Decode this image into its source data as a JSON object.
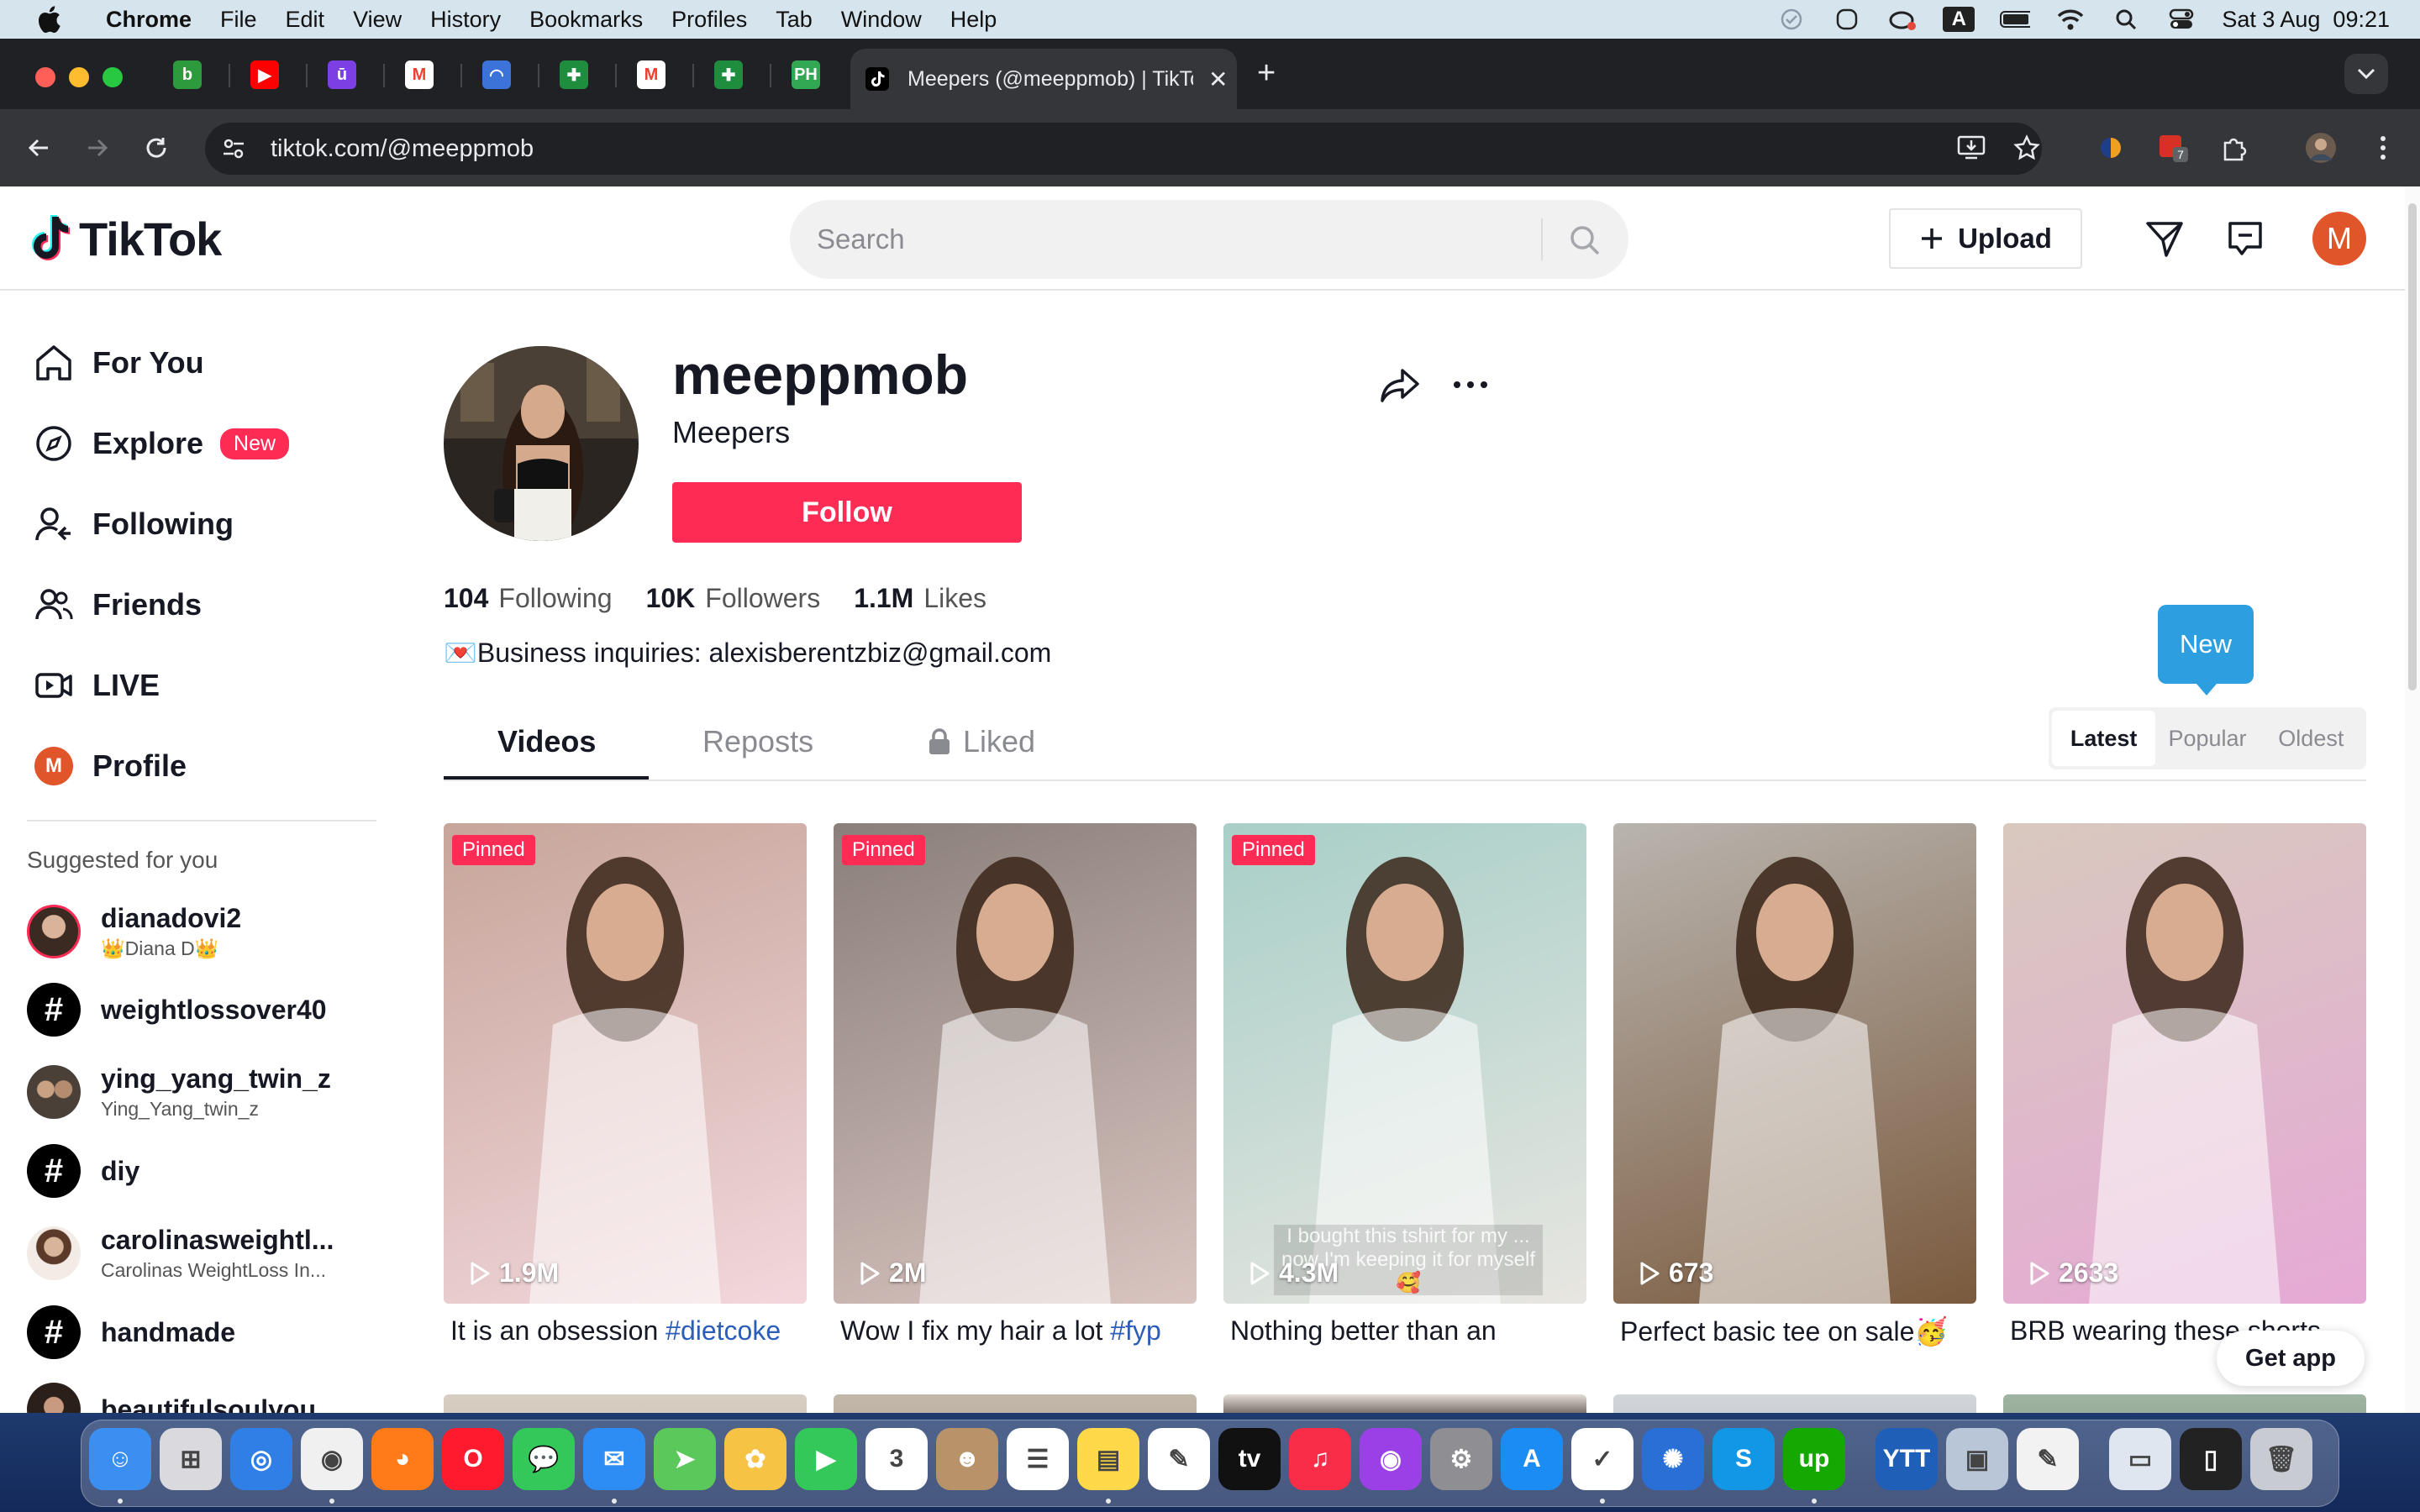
{
  "menubar": {
    "app": "Chrome",
    "items": [
      "File",
      "Edit",
      "View",
      "History",
      "Bookmarks",
      "Profiles",
      "Tab",
      "Window",
      "Help"
    ],
    "clock": "Sat 3 Aug  09:21",
    "input_indicator": "A"
  },
  "browser": {
    "active_tab_title": "Meepers (@meeppmob) | TikTok",
    "url": "tiktok.com/@meeppmob",
    "new_tab": "+",
    "close_tab": "✕",
    "pinned_tabs": [
      {
        "icon": "b-green-icon",
        "letter": "b",
        "color": "#2e9a3e"
      },
      {
        "icon": "youtube-icon",
        "letter": "▶",
        "color": "#ff0000"
      },
      {
        "icon": "u-purple-icon",
        "letter": "ū",
        "color": "#7b3fe4"
      },
      {
        "icon": "gmail-icon",
        "letter": "M",
        "color": "#ea4335"
      },
      {
        "icon": "blue-globe-icon",
        "letter": "◠",
        "color": "#3b73d9"
      },
      {
        "icon": "sheets-plus-icon",
        "letter": "✚",
        "color": "#1e8e3e"
      },
      {
        "icon": "gmail-icon",
        "letter": "M",
        "color": "#ea4335"
      },
      {
        "icon": "sheets-plus-icon",
        "letter": "✚",
        "color": "#1e8e3e"
      },
      {
        "icon": "ph-icon",
        "letter": "PH",
        "color": "#33a852"
      }
    ],
    "extension_badge": "7"
  },
  "tiktok": {
    "brand": "TikTok",
    "search_placeholder": "Search",
    "upload_label": "Upload",
    "user_initial": "M",
    "nav": [
      {
        "label": "For You",
        "icon": "home-icon"
      },
      {
        "label": "Explore",
        "icon": "compass-icon",
        "badge": "New"
      },
      {
        "label": "Following",
        "icon": "following-icon"
      },
      {
        "label": "Friends",
        "icon": "friends-icon"
      },
      {
        "label": "LIVE",
        "icon": "live-icon"
      },
      {
        "label": "Profile",
        "icon": "profile-avatar"
      }
    ],
    "suggested_title": "Suggested for you",
    "suggested": [
      {
        "name": "dianadovi2",
        "sub": "👑Diana D👑",
        "kind": "avatar"
      },
      {
        "name": "weightlossover40",
        "sub": "",
        "kind": "hashtag"
      },
      {
        "name": "ying_yang_twin_z",
        "sub": "Ying_Yang_twin_z",
        "kind": "avatar"
      },
      {
        "name": "diy",
        "sub": "",
        "kind": "hashtag"
      },
      {
        "name": "carolinasweightl...",
        "sub": "Carolinas WeightLoss In...",
        "kind": "avatar"
      },
      {
        "name": "handmade",
        "sub": "",
        "kind": "hashtag"
      },
      {
        "name": "beautifulsoulyou...",
        "sub": "",
        "kind": "avatar"
      }
    ],
    "hashtag_symbol": "#",
    "profile": {
      "username": "meeppmob",
      "display_name": "Meepers",
      "follow_label": "Follow",
      "following_count": "104",
      "following_label": "Following",
      "followers_count": "10K",
      "followers_label": "Followers",
      "likes_count": "1.1M",
      "likes_label": "Likes",
      "bio": "💌Business inquiries: alexisberentzbiz@gmail.com"
    },
    "tabs": {
      "videos": "Videos",
      "reposts": "Reposts",
      "liked": "Liked"
    },
    "tooltip_new": "New",
    "sort": {
      "latest": "Latest",
      "popular": "Popular",
      "oldest": "Oldest",
      "selected": "Latest"
    },
    "videos": [
      {
        "pinned": "Pinned",
        "views": "1.9M",
        "caption": "It is an obsession ",
        "tag": "#dietcoke",
        "overlay": "",
        "colors": [
          "#c7a59a",
          "#f2d7dc"
        ]
      },
      {
        "pinned": "Pinned",
        "views": "2M",
        "caption": "Wow I fix my hair a lot ",
        "tag": "#fyp",
        "overlay": "",
        "colors": [
          "#8a7f7a",
          "#d9c4c0"
        ]
      },
      {
        "pinned": "Pinned",
        "views": "4.3M",
        "caption": "Nothing better than an",
        "tag": "",
        "overlay": "I bought this tshirt for my ... now I'm keeping it for myself🥰",
        "colors": [
          "#a8cfc8",
          "#e8e6e1"
        ]
      },
      {
        "pinned": "",
        "views": "673",
        "caption": "Perfect basic tee on sale🥳",
        "tag": "",
        "overlay": "",
        "colors": [
          "#b9b4ae",
          "#7a5a3e"
        ]
      },
      {
        "pinned": "",
        "views": "2633",
        "caption": "BRB wearing these shorts",
        "tag": "",
        "overlay": "",
        "colors": [
          "#d8c9be",
          "#e6a9d6"
        ]
      }
    ],
    "get_app": "Get app"
  },
  "dock": {
    "apps": [
      {
        "name": "finder-icon",
        "color": "#3a8ff0",
        "glyph": "☺"
      },
      {
        "name": "launchpad-icon",
        "color": "#d9d9de",
        "glyph": "⊞"
      },
      {
        "name": "safari-icon",
        "color": "#2f7fe6",
        "glyph": "◎"
      },
      {
        "name": "chrome-icon",
        "color": "#f0f0f0",
        "glyph": "◉"
      },
      {
        "name": "firefox-icon",
        "color": "#ff7a18",
        "glyph": "◕"
      },
      {
        "name": "opera-icon",
        "color": "#ff1b2d",
        "glyph": "O"
      },
      {
        "name": "messages-icon",
        "color": "#34c759",
        "glyph": "💬"
      },
      {
        "name": "mail-icon",
        "color": "#2e8cf5",
        "glyph": "✉"
      },
      {
        "name": "maps-icon",
        "color": "#5ac85a",
        "glyph": "➤"
      },
      {
        "name": "photos-icon",
        "color": "#f6c344",
        "glyph": "✿"
      },
      {
        "name": "facetime-icon",
        "color": "#34c759",
        "glyph": "▶"
      },
      {
        "name": "calendar-icon",
        "color": "#ffffff",
        "glyph": "3"
      },
      {
        "name": "contacts-icon",
        "color": "#b8936a",
        "glyph": "☻"
      },
      {
        "name": "reminders-icon",
        "color": "#ffffff",
        "glyph": "☰"
      },
      {
        "name": "notes-icon",
        "color": "#ffd94a",
        "glyph": "▤"
      },
      {
        "name": "freeform-icon",
        "color": "#ffffff",
        "glyph": "✎"
      },
      {
        "name": "apple-tv-icon",
        "color": "#111111",
        "glyph": "tv"
      },
      {
        "name": "music-icon",
        "color": "#fa2d48",
        "glyph": "♫"
      },
      {
        "name": "podcasts-icon",
        "color": "#9b40e6",
        "glyph": "◉"
      },
      {
        "name": "system-settings-icon",
        "color": "#8e8e93",
        "glyph": "⚙"
      },
      {
        "name": "app-store-icon",
        "color": "#1c8cf5",
        "glyph": "A"
      },
      {
        "name": "omnifocus-icon",
        "color": "#ffffff",
        "glyph": "✓"
      },
      {
        "name": "network-icon",
        "color": "#2a6fd6",
        "glyph": "✺"
      },
      {
        "name": "skype-icon",
        "color": "#1296e6",
        "glyph": "S"
      },
      {
        "name": "upwork-icon",
        "color": "#14a800",
        "glyph": "up"
      },
      {
        "name": "ytt-icon",
        "color": "#1f5fb8",
        "glyph": "YTT"
      },
      {
        "name": "preview-icon",
        "color": "#b9c6d8",
        "glyph": "▣"
      },
      {
        "name": "textedit-icon",
        "color": "#f2f2f2",
        "glyph": "✎"
      },
      {
        "name": "window-thumb-icon",
        "color": "#dfe6ef",
        "glyph": "▭"
      },
      {
        "name": "phone-thumb-icon",
        "color": "#222222",
        "glyph": "▯"
      },
      {
        "name": "trash-icon",
        "color": "#c8ccd2",
        "glyph": "🗑"
      }
    ]
  }
}
